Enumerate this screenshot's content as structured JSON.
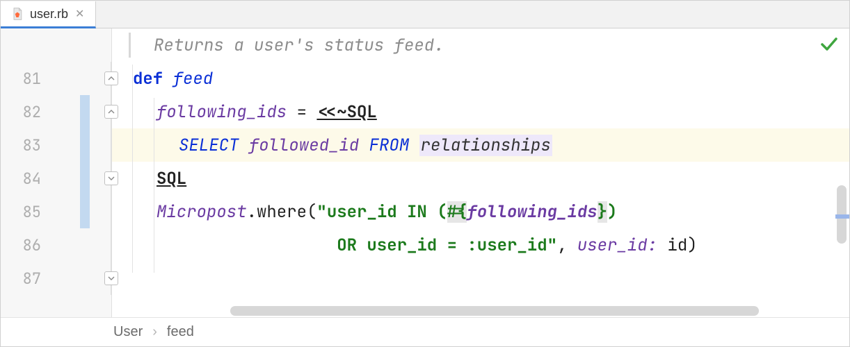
{
  "tab": {
    "filename": "user.rb",
    "icon": "ruby-file-icon"
  },
  "gutter": {
    "lines": [
      "",
      "81",
      "82",
      "83",
      "84",
      "85",
      "86",
      "87"
    ]
  },
  "code": {
    "doc_comment": "Returns a user's status feed.",
    "l81": {
      "def": "def",
      "name": "feed"
    },
    "l82": {
      "var": "following_ids",
      "eq": " = ",
      "heredoc": "<<~SQL"
    },
    "l83": {
      "select": "SELECT",
      "col": "followed_id",
      "from": "FROM",
      "table": "relationships"
    },
    "l84": {
      "close": "SQL"
    },
    "l85": {
      "const": "Micropost",
      "dot_where": ".where(",
      "str1": "\"user_id IN (",
      "interp_open": "#{",
      "interp_var": "following_ids",
      "interp_close": "}",
      "str2": ")"
    },
    "l86": {
      "str": "                  OR user_id = :user_id\"",
      "comma": ", ",
      "key": "user_id:",
      "sp": " ",
      "id": "id",
      "paren": ")"
    }
  },
  "breadcrumb": {
    "item1": "User",
    "item2": "feed"
  },
  "status": {
    "ok": true
  }
}
